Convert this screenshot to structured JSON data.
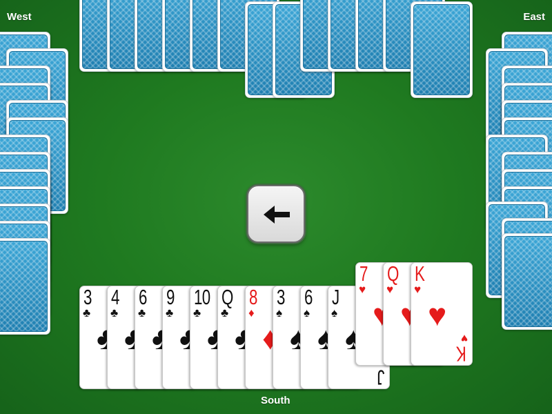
{
  "seats": {
    "west": "West",
    "east": "East",
    "south": "South"
  },
  "north_hand": {
    "card_count": 13,
    "face": "down"
  },
  "west_hand": {
    "card_count": 13,
    "face": "down"
  },
  "east_hand": {
    "card_count": 13,
    "face": "down"
  },
  "south_hand": {
    "cards": [
      {
        "rank": "3",
        "suit": "♣",
        "color": "black"
      },
      {
        "rank": "4",
        "suit": "♣",
        "color": "black"
      },
      {
        "rank": "6",
        "suit": "♣",
        "color": "black"
      },
      {
        "rank": "9",
        "suit": "♣",
        "color": "black"
      },
      {
        "rank": "10",
        "suit": "♣",
        "color": "black"
      },
      {
        "rank": "Q",
        "suit": "♣",
        "color": "black"
      },
      {
        "rank": "8",
        "suit": "♦",
        "color": "red"
      },
      {
        "rank": "3",
        "suit": "♠",
        "color": "black"
      },
      {
        "rank": "6",
        "suit": "♠",
        "color": "black"
      },
      {
        "rank": "J",
        "suit": "♠",
        "color": "black"
      },
      {
        "rank": "7",
        "suit": "♥",
        "color": "red"
      },
      {
        "rank": "Q",
        "suit": "♥",
        "color": "red"
      },
      {
        "rank": "K",
        "suit": "♥",
        "color": "red"
      }
    ],
    "selected_count": 3
  },
  "undo_button": {
    "icon": "arrow-left-icon"
  },
  "colors": {
    "felt": "#1f7a20",
    "card_back": "#2a95c6",
    "red_suit": "#e51b1b",
    "black_suit": "#111111"
  }
}
